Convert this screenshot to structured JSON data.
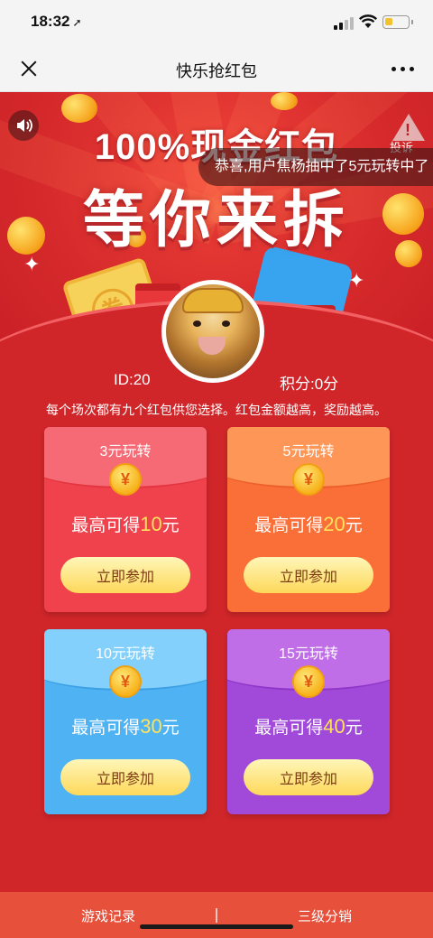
{
  "status_bar": {
    "time": "18:32",
    "battery_level": 0.35,
    "battery_color": "#f2c22e"
  },
  "nav": {
    "title": "快乐抢红包"
  },
  "banner": {
    "title_line1": "100%现金红包",
    "title_line2": "等你来拆",
    "report_label": "投诉",
    "ticker_text": "恭喜,用户焦杨抽中了5元玩转中了"
  },
  "user": {
    "id_label": "ID:20",
    "score_label": "积分:0分"
  },
  "info_text": "每个场次都有九个红包供您选择。红包金额越高，奖励越高。",
  "cards": [
    {
      "name": "3元玩转",
      "prefix": "最高可得",
      "amount": "10",
      "unit": "元",
      "button": "立即参加",
      "color": "#f0424d"
    },
    {
      "name": "5元玩转",
      "prefix": "最高可得",
      "amount": "20",
      "unit": "元",
      "button": "立即参加",
      "color": "#fa6f38"
    },
    {
      "name": "10元玩转",
      "prefix": "最高可得",
      "amount": "30",
      "unit": "元",
      "button": "立即参加",
      "color": "#4fb3f3"
    },
    {
      "name": "15元玩转",
      "prefix": "最高可得",
      "amount": "40",
      "unit": "元",
      "button": "立即参加",
      "color": "#a14ad9"
    }
  ],
  "coin_symbol": "¥",
  "bottom_bar": {
    "left": "游戏记录",
    "right": "三级分销",
    "color": "#e7503a"
  },
  "icons": [
    "location-arrow-icon",
    "signal-icon",
    "wifi-icon",
    "battery-icon",
    "close-icon",
    "more-icon",
    "speaker-icon",
    "warning-icon",
    "yen-coin-icon"
  ]
}
